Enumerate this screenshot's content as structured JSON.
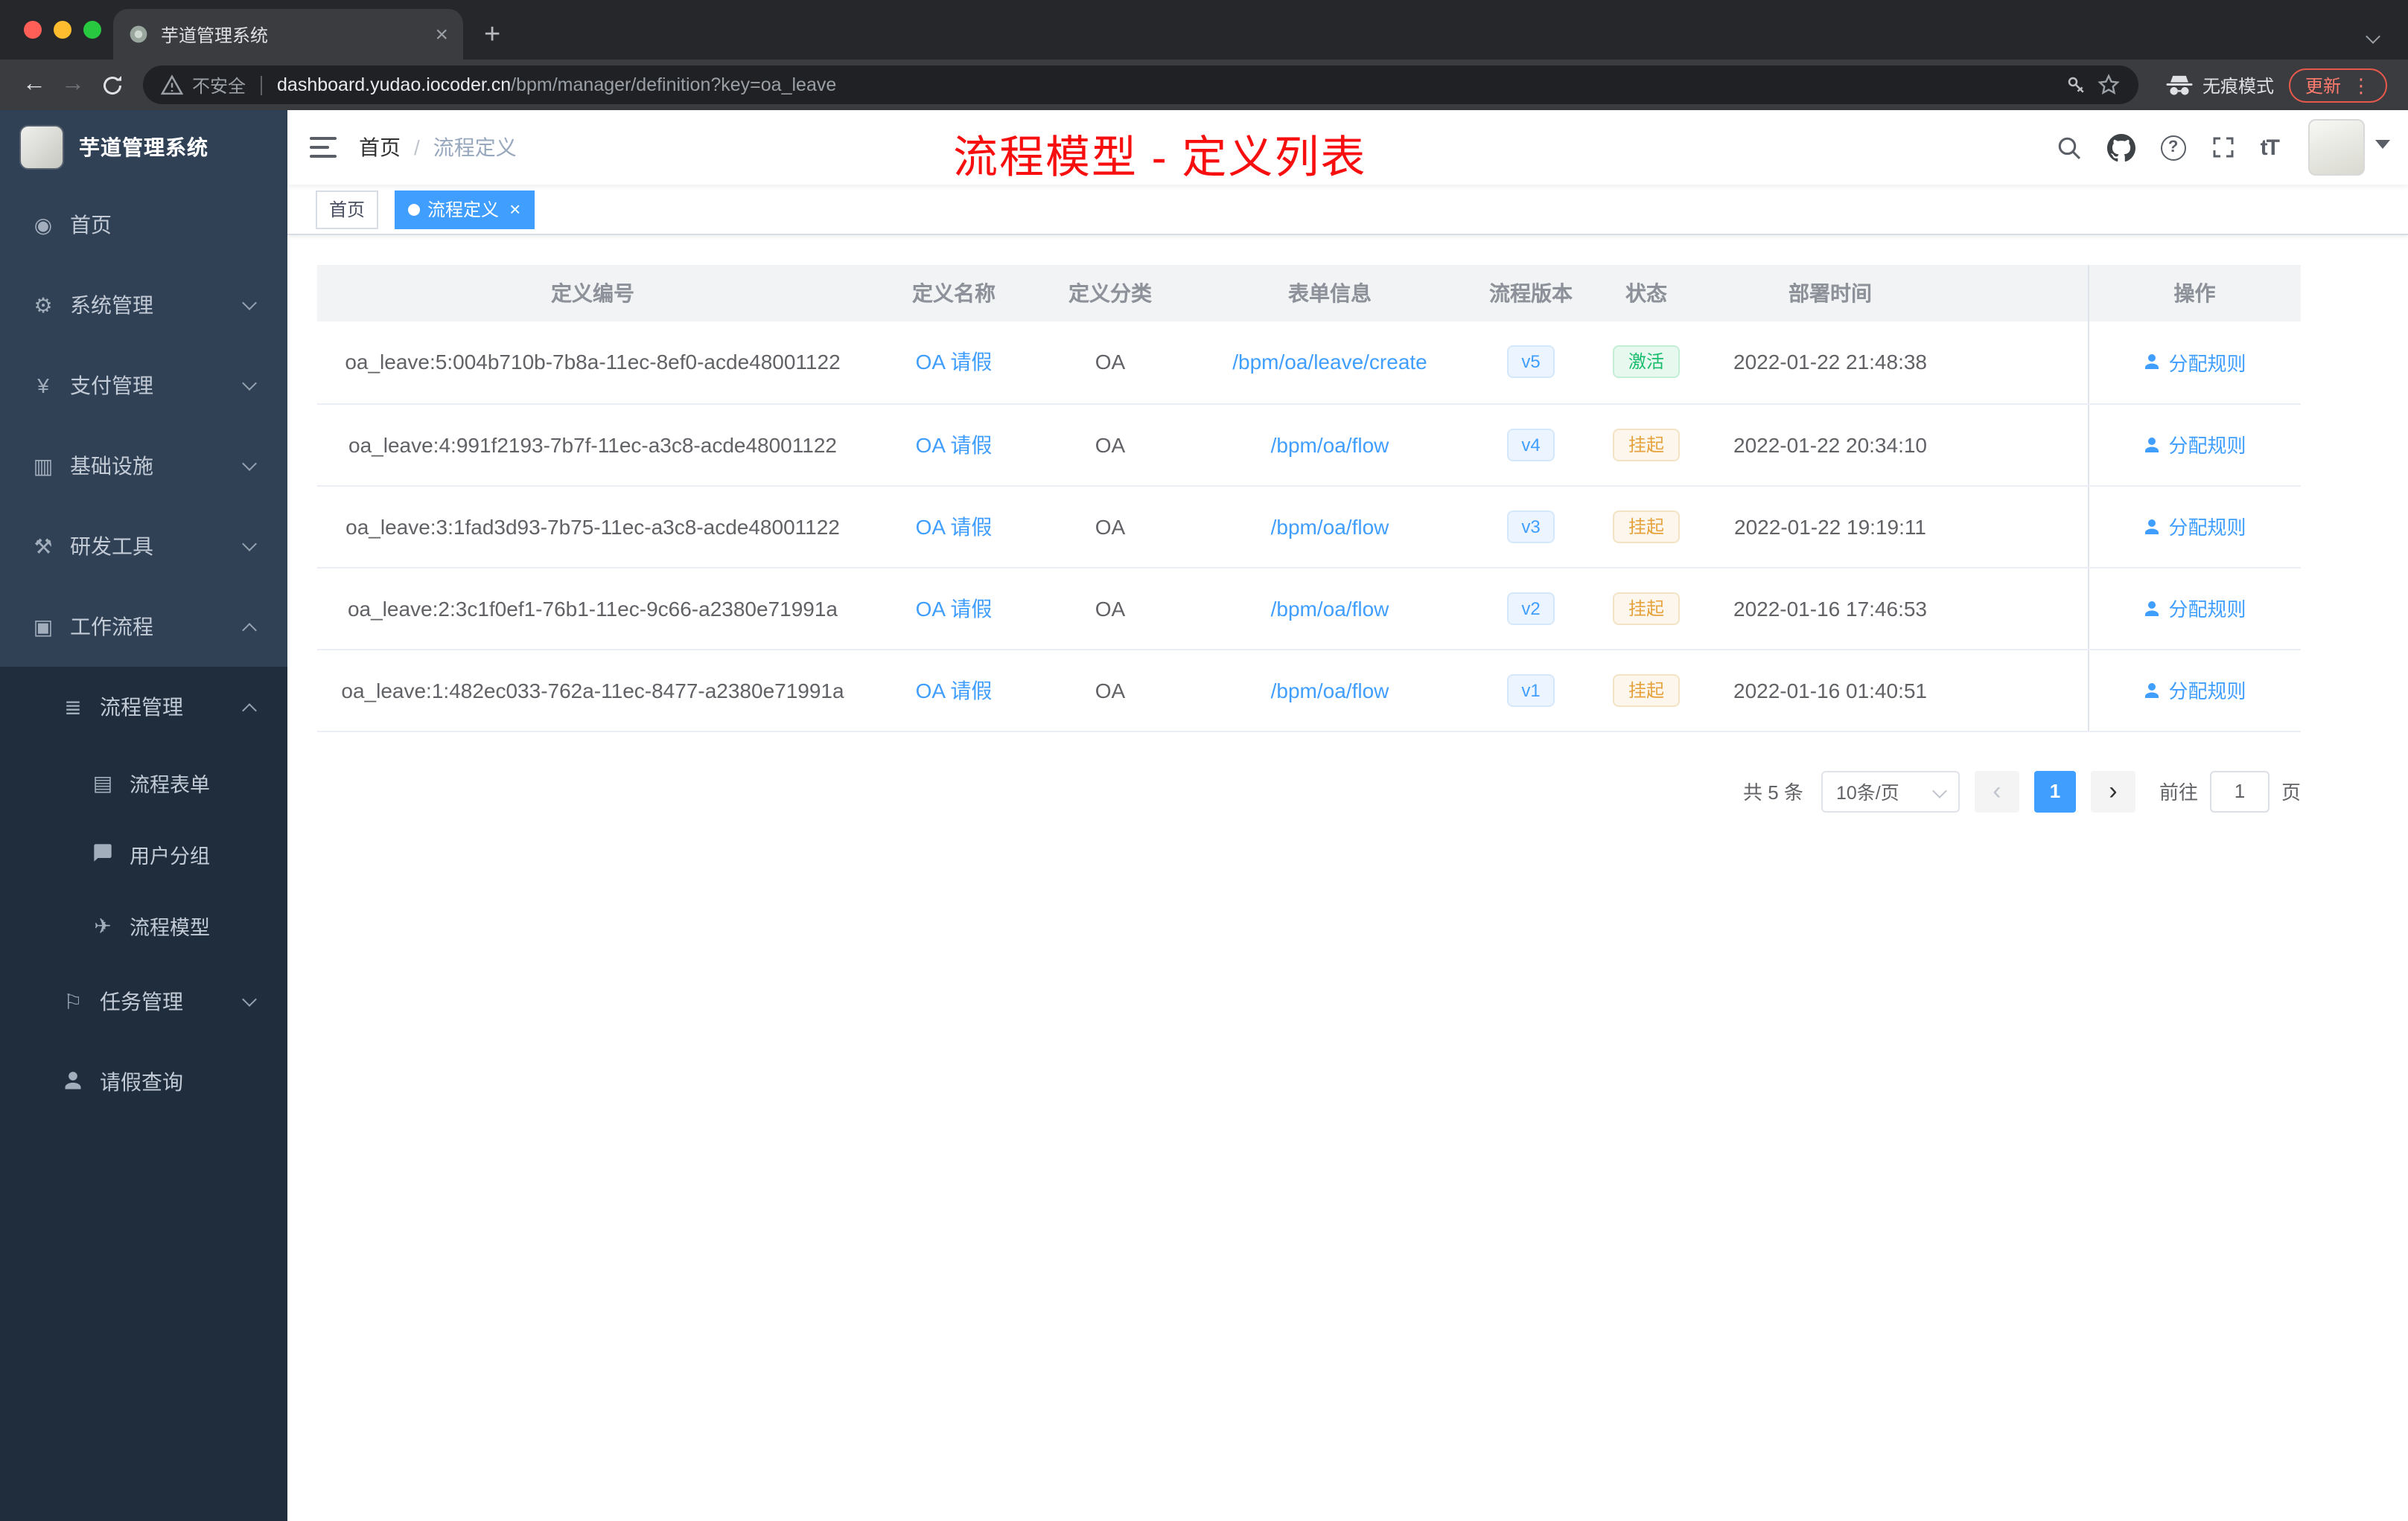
{
  "colors": {
    "accent": "#409eff",
    "annotation_red": "#f70f0f",
    "sidebar_bg": "#304156",
    "submenu_bg": "#1f2d3d",
    "success_green": "#18bd6c",
    "warning_orange": "#e6a23c"
  },
  "browser": {
    "tab_title": "芋道管理系统",
    "tab_close": "×",
    "new_tab": "+",
    "security_label": "不安全",
    "url_domain": "dashboard.yudao.iocoder.cn",
    "url_path": "/bpm/manager/definition?key=oa_leave",
    "incognito_label": "无痕模式",
    "update_label": "更新",
    "menu_dots": "⋮",
    "back_glyph": "←",
    "forward_glyph": "→"
  },
  "sidebar": {
    "logo_title": "芋道管理系统",
    "items": [
      {
        "label": "首页",
        "icon": "dashboard-icon",
        "glyph": "◉"
      },
      {
        "label": "系统管理",
        "icon": "gear-icon",
        "glyph": "⚙",
        "expand": "down"
      },
      {
        "label": "支付管理",
        "icon": "yen-icon",
        "glyph": "¥",
        "expand": "down"
      },
      {
        "label": "基础设施",
        "icon": "infrastructure-icon",
        "glyph": "▥",
        "expand": "down"
      },
      {
        "label": "研发工具",
        "icon": "tools-icon",
        "glyph": "⚒",
        "expand": "down"
      },
      {
        "label": "工作流程",
        "icon": "workflow-icon",
        "glyph": "▣",
        "expand": "up"
      },
      {
        "label": "流程管理",
        "icon": "process-list-icon",
        "glyph": "≣",
        "expand": "up"
      },
      {
        "label": "流程表单",
        "icon": "form-icon",
        "glyph": "▤"
      },
      {
        "label": "用户分组",
        "icon": "user-group-icon"
      },
      {
        "label": "流程模型",
        "icon": "process-model-icon",
        "glyph": "✈"
      },
      {
        "label": "任务管理",
        "icon": "task-icon",
        "glyph": "⚐",
        "expand": "down"
      },
      {
        "label": "请假查询",
        "icon": "person-icon"
      }
    ]
  },
  "navbar": {
    "breadcrumb": {
      "home": "首页",
      "separator": "/",
      "current": "流程定义"
    },
    "annotation": "流程模型 - 定义列表",
    "help_glyph": "?",
    "font_icon_label": "tT"
  },
  "tags": {
    "close_glyph": "×",
    "items": [
      {
        "label": "首页",
        "active": false
      },
      {
        "label": "流程定义",
        "active": true
      }
    ]
  },
  "table": {
    "headers": [
      "定义编号",
      "定义名称",
      "定义分类",
      "表单信息",
      "流程版本",
      "状态",
      "部署时间",
      "操作"
    ],
    "rows": [
      {
        "id": "oa_leave:5:004b710b-7b8a-11ec-8ef0-acde48001122",
        "name": "OA 请假",
        "category": "OA",
        "form": "/bpm/oa/leave/create",
        "version": "v5",
        "status": "激活",
        "status_type": "success",
        "deploy_time": "2022-01-22 21:48:38",
        "action": "分配规则"
      },
      {
        "id": "oa_leave:4:991f2193-7b7f-11ec-a3c8-acde48001122",
        "name": "OA 请假",
        "category": "OA",
        "form": "/bpm/oa/flow",
        "version": "v4",
        "status": "挂起",
        "status_type": "warning",
        "deploy_time": "2022-01-22 20:34:10",
        "action": "分配规则"
      },
      {
        "id": "oa_leave:3:1fad3d93-7b75-11ec-a3c8-acde48001122",
        "name": "OA 请假",
        "category": "OA",
        "form": "/bpm/oa/flow",
        "version": "v3",
        "status": "挂起",
        "status_type": "warning",
        "deploy_time": "2022-01-22 19:19:11",
        "action": "分配规则"
      },
      {
        "id": "oa_leave:2:3c1f0ef1-76b1-11ec-9c66-a2380e71991a",
        "name": "OA 请假",
        "category": "OA",
        "form": "/bpm/oa/flow",
        "version": "v2",
        "status": "挂起",
        "status_type": "warning",
        "deploy_time": "2022-01-16 17:46:53",
        "action": "分配规则"
      },
      {
        "id": "oa_leave:1:482ec033-762a-11ec-8477-a2380e71991a",
        "name": "OA 请假",
        "category": "OA",
        "form": "/bpm/oa/flow",
        "version": "v1",
        "status": "挂起",
        "status_type": "warning",
        "deploy_time": "2022-01-16 01:40:51",
        "action": "分配规则"
      }
    ]
  },
  "pagination": {
    "total": "共 5 条",
    "page_size": "10条/页",
    "prev": "‹",
    "page": "1",
    "next": "›",
    "goto_label": "前往",
    "goto_value": "1",
    "unit": "页"
  }
}
